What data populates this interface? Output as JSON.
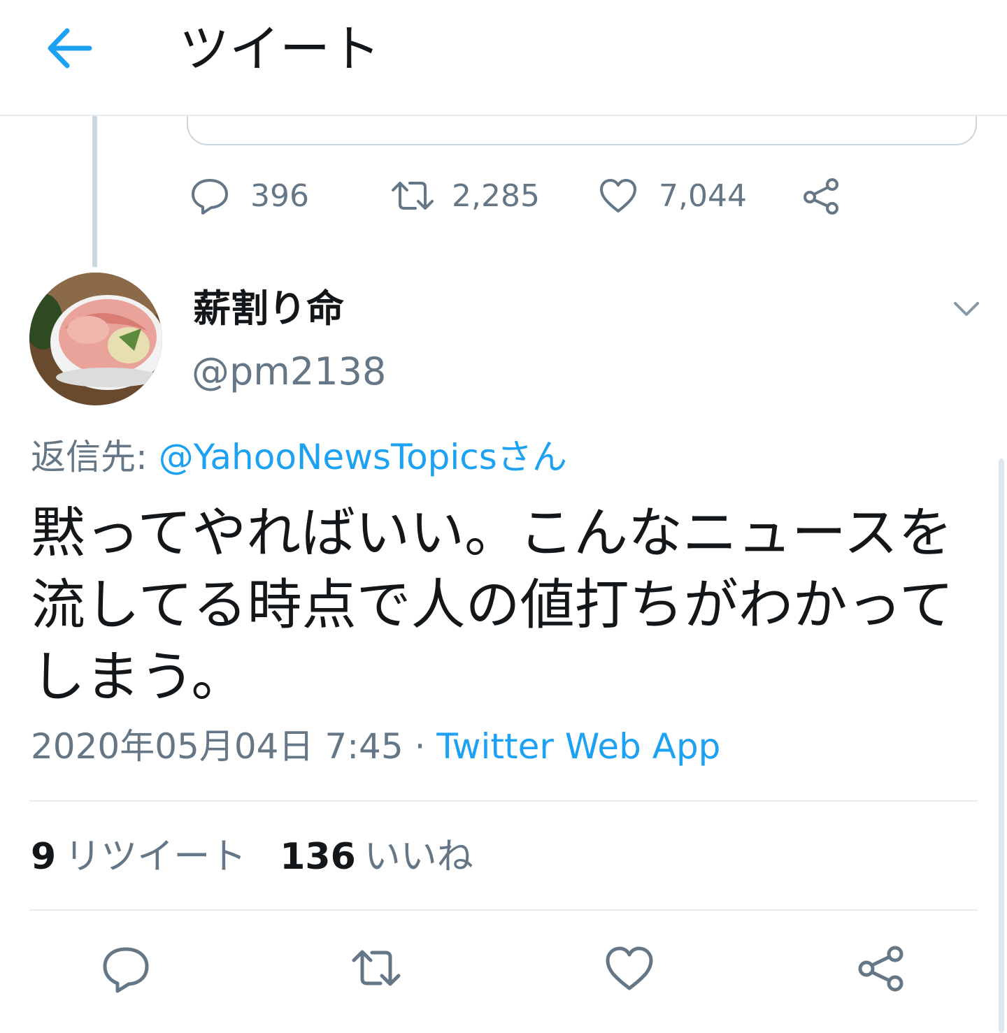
{
  "header": {
    "title": "ツイート"
  },
  "parent_tweet": {
    "replies": "396",
    "retweets": "2,285",
    "likes": "7,044"
  },
  "tweet": {
    "display_name": "薪割り命",
    "handle": "@pm2138",
    "reply_prefix": "返信先: ",
    "reply_to": "@YahooNewsTopicsさん",
    "text": "黙ってやればいい。こんなニュースを流してる時点で人の値打ちがわかってしまう。",
    "timestamp": "2020年05月04日 7:45",
    "separator": " · ",
    "source": "Twitter Web App",
    "retweet_count": "9",
    "retweet_label": "リツイート",
    "like_count": "136",
    "like_label": "いいね"
  },
  "colors": {
    "accent": "#1da1f2",
    "secondary_text": "#657786",
    "border": "#e6ecf0"
  },
  "icons": {
    "back": "arrow-left-icon",
    "reply": "speech-bubble-icon",
    "retweet": "retweet-arrows-icon",
    "like": "heart-icon",
    "share": "share-nodes-icon",
    "more": "chevron-down-icon"
  }
}
